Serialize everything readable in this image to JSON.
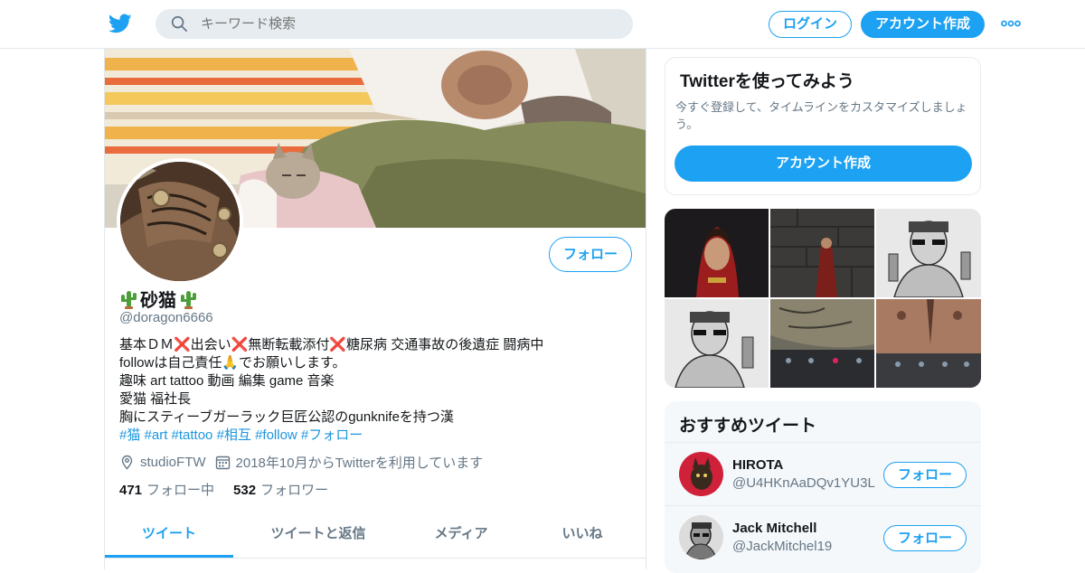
{
  "header": {
    "search_placeholder": "キーワード検索",
    "login_label": "ログイン",
    "signup_label": "アカウント作成",
    "brand_color": "#1da1f2"
  },
  "profile": {
    "follow_label": "フォロー",
    "name": "砂猫",
    "name_emoji": "cactus",
    "handle": "@doragon6666",
    "bio_lines": [
      "基本ＤＭ❌出会い❌無断転載添付❌糖尿病 交通事故の後遺症 闘病中",
      "followは自己責任🙏でお願いします。",
      "趣味 art tattoo 動画 編集 game 音楽",
      "愛猫 福社長",
      "胸にスティーブガーラック巨匠公認のgunknifeを持つ漢"
    ],
    "hashtags": "#猫 #art #tattoo #相互 #follow #フォロー",
    "location": "studioFTW",
    "joined": "2018年10月からTwitterを利用しています",
    "following_count": "471",
    "following_label": "フォロー中",
    "followers_count": "532",
    "followers_label": "フォロワー"
  },
  "tabs": [
    {
      "label": "ツイート",
      "active": true
    },
    {
      "label": "ツイートと返信",
      "active": false
    },
    {
      "label": "メディア",
      "active": false
    },
    {
      "label": "いいね",
      "active": false
    }
  ],
  "signup_card": {
    "title": "Twitterを使ってみよう",
    "text": "今すぐ登録して、タイムラインをカスタマイズしましょう。",
    "button_label": "アカウント作成"
  },
  "recommendations": {
    "title": "おすすめツイート",
    "items": [
      {
        "name": "HIROTA",
        "handle": "@U4HKnAaDQv1YU3L",
        "button_label": "フォロー"
      },
      {
        "name": "Jack Mitchell",
        "handle": "@JackMitchel19",
        "button_label": "フォロー"
      }
    ]
  }
}
